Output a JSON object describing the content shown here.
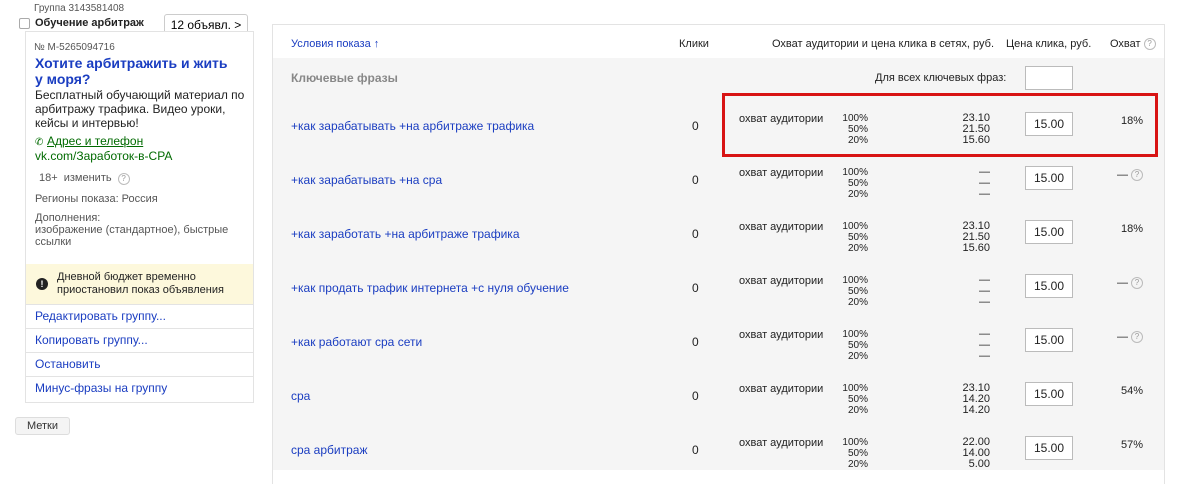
{
  "group": {
    "id_label": "Группа 3143581408",
    "name": "Обучение арбитраж",
    "ads_button": "12 объявл. >"
  },
  "ad": {
    "number": "№ М-5265094716",
    "title": "Хотите арбитражить и жить у моря?",
    "text": "Бесплатный обучающий материал по арбитражу трафика. Видео уроки, кейсы и интервью!",
    "contacts": "Адрес и телефон",
    "url": "vk.com/Заработок-в-СРА",
    "age": "18+",
    "age_edit": "изменить",
    "regions": "Регионы показа: Россия",
    "extras_label": "Дополнения:",
    "extras_value": "изображение (стандартное), быстрые ссылки",
    "warning": "Дневной бюджет временно приостановил показ объявления",
    "links": [
      "Редактировать группу...",
      "Копировать группу...",
      "Остановить",
      "Минус-фразы на группу"
    ],
    "tags_button": "Метки"
  },
  "table": {
    "headers": {
      "conditions": "Условия показа ↑",
      "clicks": "Клики",
      "reach": "Охват аудитории и цена клика в сетях, руб.",
      "price": "Цена клика, руб.",
      "coverage": "Охват"
    },
    "section_title": "Ключевые фразы",
    "all_keywords_label": "Для всех ключевых фраз:",
    "all_keywords_value": "",
    "reach_label": "охват аудитории",
    "rows": [
      {
        "phrase": "+как зарабатывать +на арбитраже трафика",
        "clicks": "0",
        "pcts": "100%\n50%\n20%",
        "prices": "23.10\n21.50\n15.60",
        "price": "15.00",
        "coverage": "18%"
      },
      {
        "phrase": "+как зарабатывать +на сра",
        "clicks": "0",
        "pcts": "100%\n50%\n20%",
        "prices": "—\n—\n—",
        "price": "15.00",
        "coverage": "—"
      },
      {
        "phrase": "+как заработать +на арбитраже трафика",
        "clicks": "0",
        "pcts": "100%\n50%\n20%",
        "prices": "23.10\n21.50\n15.60",
        "price": "15.00",
        "coverage": "18%"
      },
      {
        "phrase": "+как продать трафик интернета +с нуля обучение",
        "clicks": "0",
        "pcts": "100%\n50%\n20%",
        "prices": "—\n—\n—",
        "price": "15.00",
        "coverage": "—"
      },
      {
        "phrase": "+как работают сра сети",
        "clicks": "0",
        "pcts": "100%\n50%\n20%",
        "prices": "—\n—\n—",
        "price": "15.00",
        "coverage": "—"
      },
      {
        "phrase": "сра",
        "clicks": "0",
        "pcts": "100%\n50%\n20%",
        "prices": "23.10\n14.20\n14.20",
        "price": "15.00",
        "coverage": "54%"
      },
      {
        "phrase": "сра арбитраж",
        "clicks": "0",
        "pcts": "100%\n50%\n20%",
        "prices": "22.00\n14.00\n5.00",
        "price": "15.00",
        "coverage": "57%"
      }
    ]
  },
  "colors": {
    "link": "#1a3dc1",
    "highlight": "#d81414",
    "warning_bg": "#fdf8dc",
    "green": "#006a00"
  }
}
